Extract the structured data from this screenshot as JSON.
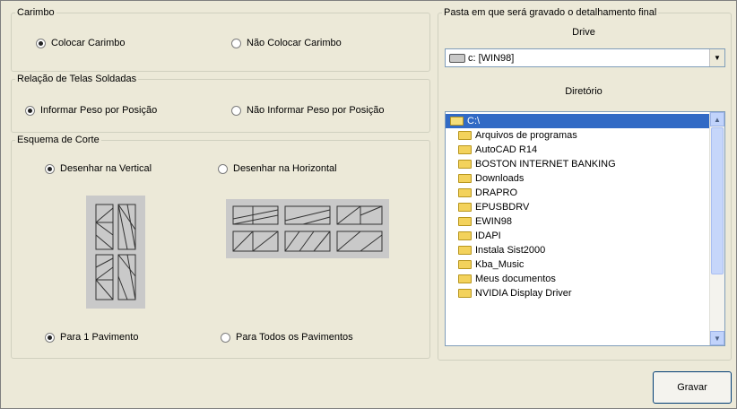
{
  "carimbo": {
    "legend": "Carimbo",
    "opt_colocar": "Colocar Carimbo",
    "opt_nao_colocar": "Não Colocar Carimbo"
  },
  "telas": {
    "legend": "Relação de Telas Soldadas",
    "opt_informar": "Informar Peso por Posição",
    "opt_nao_informar": "Não Informar Peso por Posição"
  },
  "esquema": {
    "legend": "Esquema de Corte",
    "opt_vertical": "Desenhar na Vertical",
    "opt_horizontal": "Desenhar na Horizontal",
    "opt_um_pav": "Para 1 Pavimento",
    "opt_todos_pav": "Para Todos os Pavimentos"
  },
  "pasta": {
    "legend": "Pasta em que será gravado o detalhamento final",
    "drive_label": "Drive",
    "drive_value": "c: [WIN98]",
    "dir_label": "Diretório",
    "folders": [
      "C:\\",
      "Arquivos de programas",
      "AutoCAD R14",
      "BOSTON INTERNET BANKING",
      "Downloads",
      "DRAPRO",
      "EPUSBDRV",
      "EWIN98",
      "IDAPI",
      "Instala Sist2000",
      "Kba_Music",
      "Meus documentos",
      "NVIDIA Display Driver"
    ]
  },
  "buttons": {
    "gravar": "Gravar"
  },
  "icons": {
    "radio": "radio-button-icon",
    "folder": "folder-icon",
    "drive": "hard-drive-icon",
    "dropdown": "chevron-down-icon",
    "scroll_up": "scroll-up-icon",
    "scroll_down": "scroll-down-icon"
  },
  "colors": {
    "face": "#ece9d8",
    "selection": "#316ac5",
    "border": "#7f9db9"
  }
}
